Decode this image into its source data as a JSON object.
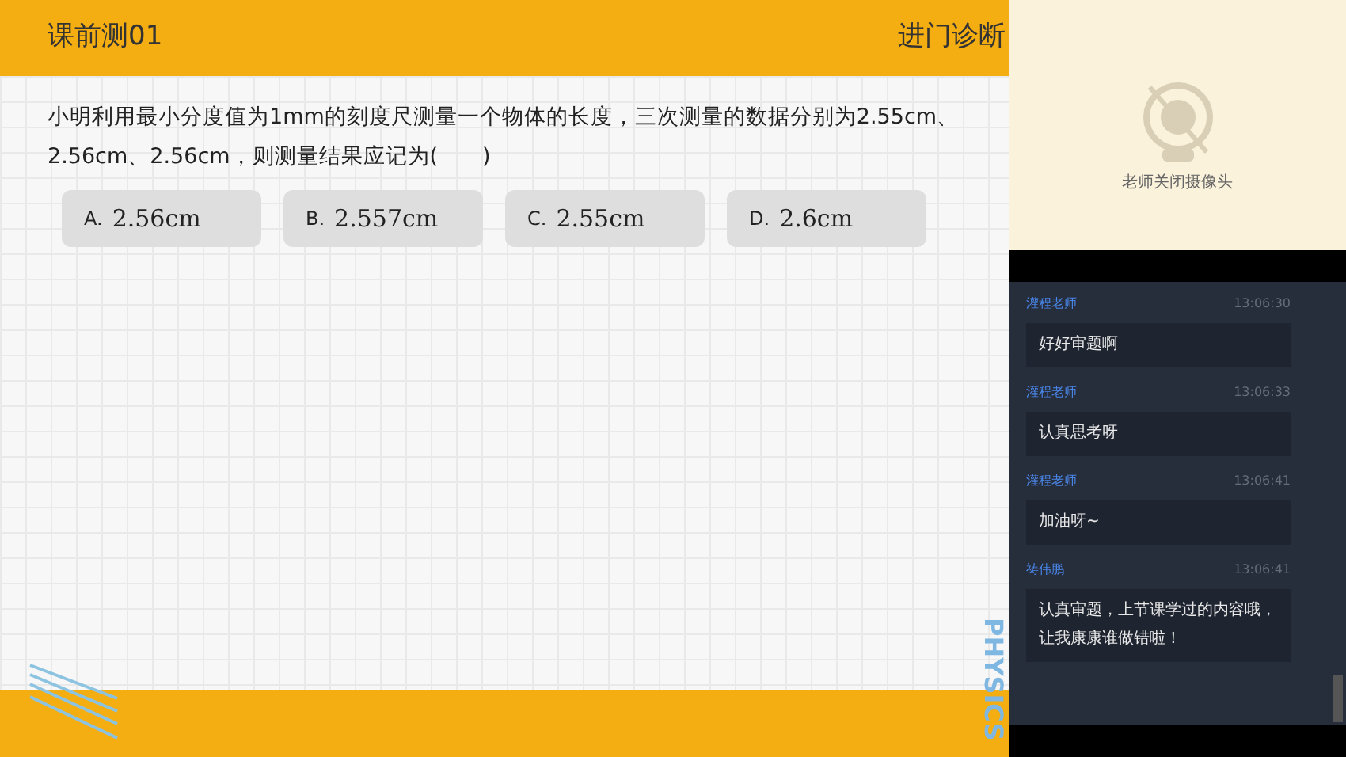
{
  "slide": {
    "title": "课前测01",
    "section": "进门诊断",
    "question": "小明利用最小分度值为1mm的刻度尺测量一个物体的长度，三次测量的数据分别为2.55cm、2.56cm、2.56cm，则测量结果应记为(　　)",
    "options": [
      {
        "letter": "A.",
        "text": "2.56cm"
      },
      {
        "letter": "B.",
        "text": "2.557cm"
      },
      {
        "letter": "C.",
        "text": "2.55cm"
      },
      {
        "letter": "D.",
        "text": "2.6cm"
      }
    ],
    "corner_text": "PHYSICS"
  },
  "camera": {
    "status": "老师关闭摄像头"
  },
  "chat": [
    {
      "sender": "灌程老师",
      "time": "13:06:30",
      "message": "好好审题啊"
    },
    {
      "sender": "灌程老师",
      "time": "13:06:33",
      "message": "认真思考呀"
    },
    {
      "sender": "灌程老师",
      "time": "13:06:41",
      "message": "加油呀~"
    },
    {
      "sender": "祷伟鹏",
      "time": "13:06:41",
      "message": "认真审题，上节课学过的内容哦，让我康康谁做错啦！"
    }
  ]
}
